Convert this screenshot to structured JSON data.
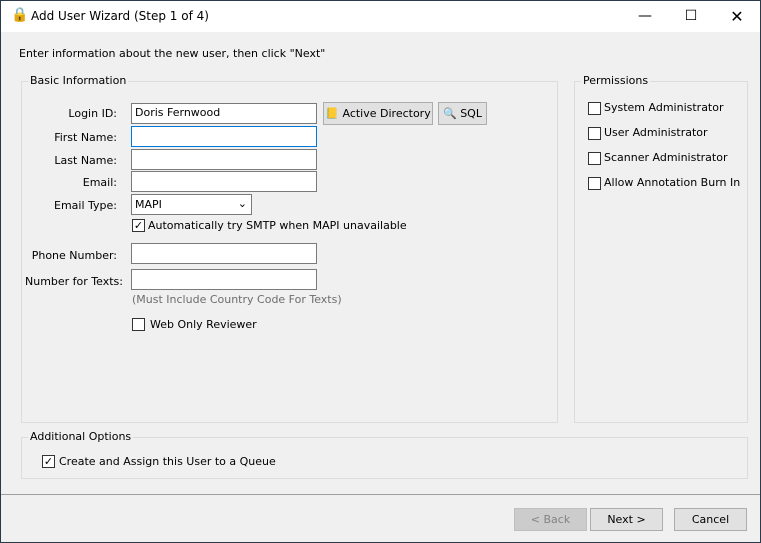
{
  "window": {
    "title": "Add User Wizard (Step 1 of 4)",
    "icon": "lock-icon"
  },
  "instructions": "Enter information about the new user, then click \"Next\"",
  "basic": {
    "legend": "Basic Information",
    "login_label": "Login ID:",
    "login_value": "Doris Fernwood",
    "ad_button": "Active Directory",
    "sql_button": "SQL",
    "first_label": "First Name:",
    "first_value": "",
    "last_label": "Last Name:",
    "last_value": "",
    "email_label": "Email:",
    "email_value": "",
    "email_type_label": "Email Type:",
    "email_type_value": "MAPI",
    "smtp_label": "Automatically try SMTP when MAPI unavailable",
    "smtp_checked": true,
    "phone_label": "Phone Number:",
    "phone_value": "",
    "texts_label": "Number for Texts:",
    "texts_value": "",
    "texts_hint": "(Must Include Country Code For Texts)",
    "web_only_label": "Web Only Reviewer",
    "web_only_checked": false
  },
  "permissions": {
    "legend": "Permissions",
    "items": [
      {
        "label": "System Administrator",
        "checked": false
      },
      {
        "label": "User Administrator",
        "checked": false
      },
      {
        "label": "Scanner Administrator",
        "checked": false
      },
      {
        "label": "Allow Annotation Burn In",
        "checked": false
      }
    ]
  },
  "additional": {
    "legend": "Additional Options",
    "queue_label": "Create and Assign this User to a Queue",
    "queue_checked": true
  },
  "footer": {
    "back": "< Back",
    "next": "Next >",
    "cancel": "Cancel"
  }
}
